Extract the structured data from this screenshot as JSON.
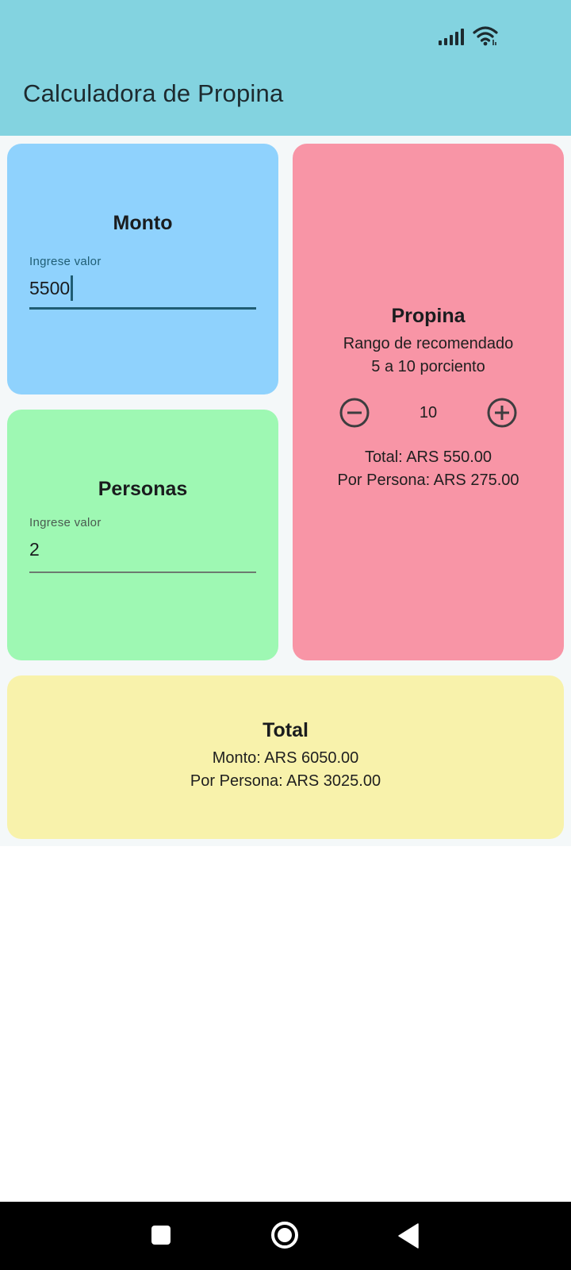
{
  "status_bar": {
    "icons": [
      "signal-icon",
      "wifi-icon"
    ]
  },
  "app": {
    "title": "Calculadora de Propina"
  },
  "monto": {
    "title": "Monto",
    "label": "Ingrese valor",
    "value": "5500"
  },
  "personas": {
    "title": "Personas",
    "label": "Ingrese valor",
    "value": "2"
  },
  "propina": {
    "title": "Propina",
    "subtitle_line1": "Rango de recomendado",
    "subtitle_line2": "5 a 10 porciento",
    "percent": "10",
    "total": "Total: ARS 550.00",
    "per_person": "Por Persona: ARS 275.00"
  },
  "total": {
    "title": "Total",
    "monto": "Monto: ARS 6050.00",
    "per_person": "Por Persona: ARS 3025.00"
  },
  "nav": {
    "buttons": [
      "recents-icon",
      "home-icon",
      "back-icon"
    ]
  },
  "colors": {
    "appbar": "#83d3e0",
    "monto_card": "#8fd2fd",
    "personas_card": "#9ef8b3",
    "propina_card": "#f895a6",
    "total_card": "#f8f2ab",
    "accent": "#1f5d74"
  }
}
